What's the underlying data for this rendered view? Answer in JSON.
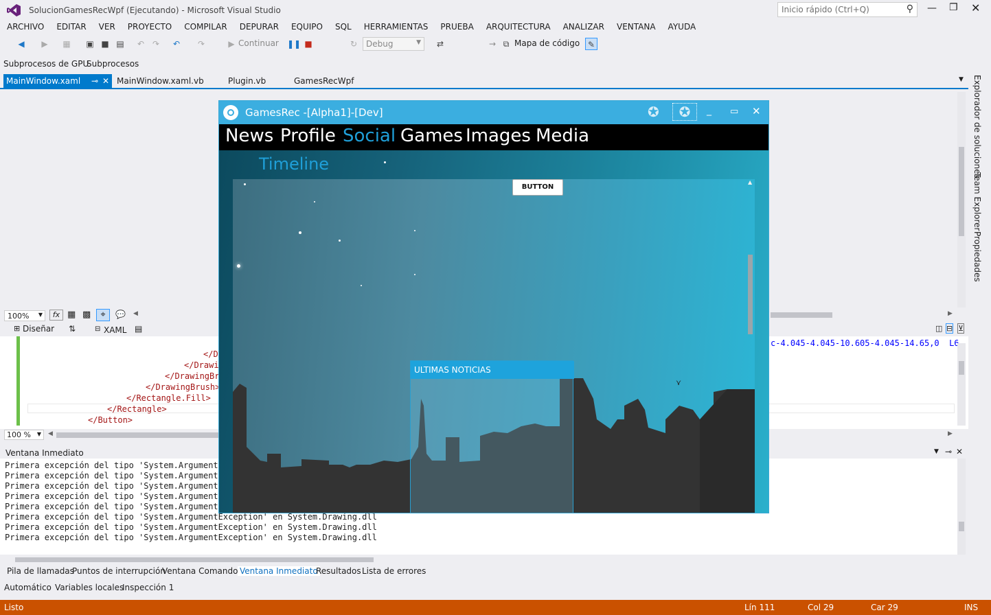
{
  "window": {
    "title": "SolucionGamesRecWpf (Ejecutando) - Microsoft Visual Studio",
    "quick_launch_placeholder": "Inicio rápido (Ctrl+Q)"
  },
  "menu": [
    "ARCHIVO",
    "EDITAR",
    "VER",
    "PROYECTO",
    "COMPILAR",
    "DEPURAR",
    "EQUIPO",
    "SQL",
    "HERRAMIENTAS",
    "PRUEBA",
    "ARQUITECTURA",
    "ANALIZAR",
    "VENTANA",
    "AYUDA"
  ],
  "toolbar": {
    "continue_label": "Continuar",
    "config_value": "Debug",
    "codemap_label": "Mapa de código"
  },
  "gpu_bar": {
    "gpu_threads": "Subprocesos de GPU",
    "threads": "Subprocesos"
  },
  "doc_tabs": [
    "MainWindow.xaml",
    "MainWindow.xaml.vb",
    "Plugin.vb",
    "GamesRecWpf"
  ],
  "designer": {
    "zoom": "100%",
    "design_tab": "Diseñar",
    "xaml_tab": "XAML",
    "code_zoom": "100 %"
  },
  "code_lines": [
    "</D",
    "</Drawi",
    "</DrawingBru",
    "</DrawingBrush>",
    "</Rectangle.Fill>",
    "</Rectangle>",
    "</Button>"
  ],
  "code_right_snippet": "c-4.045-4.045-10.605-4.045-14.65,0  L6",
  "immediate": {
    "title": "Ventana Inmediato",
    "lines": [
      "Primera excepción del tipo 'System.ArgumentEx",
      "Primera excepción del tipo 'System.ArgumentEx",
      "Primera excepción del tipo 'System.ArgumentEx",
      "Primera excepción del tipo 'System.ArgumentEx",
      "Primera excepción del tipo 'System.ArgumentEx",
      "Primera excepción del tipo 'System.ArgumentException' en System.Drawing.dll",
      "Primera excepción del tipo 'System.ArgumentException' en System.Drawing.dll",
      "Primera excepción del tipo 'System.ArgumentException' en System.Drawing.dll"
    ]
  },
  "bottom_tabs": [
    "Pila de llamadas",
    "Puntos de interrupción",
    "Ventana Comandos",
    "Ventana Inmediato",
    "Resultados",
    "Lista de errores"
  ],
  "bottom_tabs2": [
    "Automático",
    "Variables locales",
    "Inspección 1"
  ],
  "status": {
    "text": "Listo",
    "line": "Lín 111",
    "col": "Col 29",
    "car": "Car 29",
    "mode": "INS"
  },
  "right_rail": [
    "Explorador de soluciones",
    "Team Explorer",
    "Propiedades"
  ],
  "app": {
    "title": "GamesRec -[Alpha1]-[Dev]",
    "nav": [
      "News",
      "Profile",
      "Social",
      "Games",
      "Images",
      "Media"
    ],
    "active_nav": "Social",
    "section_title": "Timeline",
    "button_label": "BUTTON",
    "news_header": "ULTIMAS NOTICIAS",
    "accent": "#3baee0"
  }
}
